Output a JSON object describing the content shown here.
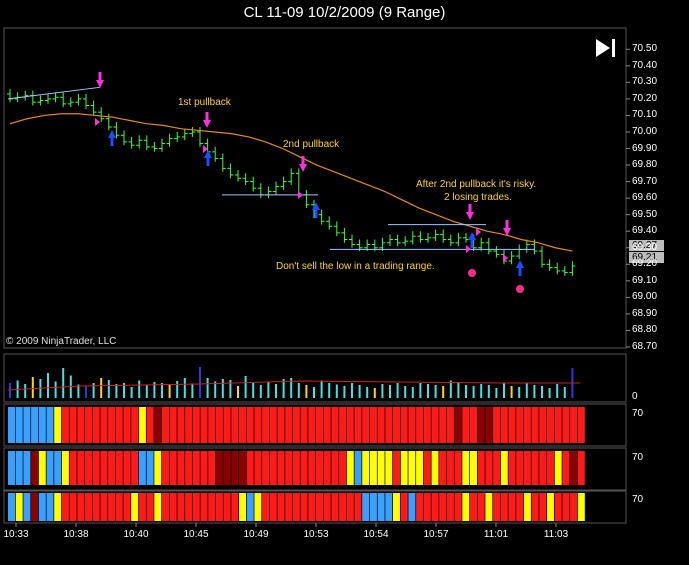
{
  "window_title": "CL 11-09  10/2/2009 (9 Range)",
  "copyright": "© 2009 NinjaTrader, LLC",
  "annotations": {
    "first_pullback": "1st pullback",
    "second_pullback": "2nd pullback",
    "after_second": "After 2nd pullback it's risky.",
    "losing_trades": "2 losing trades.",
    "dont_sell": "Don't sell the low in a trading range."
  },
  "price_badges": {
    "upper": "69.27",
    "lower": "69.21"
  },
  "indicator_labels": {
    "volume": "0",
    "ind1": "70",
    "ind2": "70",
    "ind3": "70"
  },
  "colors": {
    "up_bar": "#3cff3c",
    "down_bar": "#3cff3c",
    "ema": "#e08a20",
    "annotation": "#ffd21f",
    "signal_down": "#ff2ee0",
    "signal_up": "#1e4bff",
    "volume": "#48e0e0"
  },
  "icons": {
    "play": "skip-to-end-icon"
  },
  "chart_data": {
    "type": "ohlc",
    "title": "CL 11-09  10/2/2009 (9 Range)",
    "y_ticks": [
      "70.50",
      "70.40",
      "70.30",
      "70.20",
      "70.10",
      "70.00",
      "69.90",
      "69.80",
      "69.70",
      "69.60",
      "69.50",
      "69.40",
      "69.30",
      "69.20",
      "69.10",
      "69.00",
      "68.90",
      "68.80",
      "68.70"
    ],
    "ylim": [
      68.7,
      70.55
    ],
    "x_labels": [
      "10:33",
      "10:38",
      "10:40",
      "10:45",
      "10:49",
      "10:53",
      "10:54",
      "10:57",
      "11:01",
      "11:03"
    ],
    "closes": [
      70.2,
      70.21,
      70.22,
      70.18,
      70.19,
      70.2,
      70.21,
      70.17,
      70.18,
      70.2,
      70.16,
      70.12,
      70.08,
      70.03,
      69.98,
      69.94,
      69.92,
      69.95,
      69.91,
      69.9,
      69.93,
      69.96,
      69.97,
      69.99,
      70.0,
      69.93,
      69.88,
      69.84,
      69.78,
      69.74,
      69.72,
      69.7,
      69.66,
      69.62,
      69.64,
      69.67,
      69.7,
      69.75,
      69.62,
      69.56,
      69.5,
      69.46,
      69.43,
      69.39,
      69.35,
      69.32,
      69.3,
      69.32,
      69.3,
      69.33,
      69.35,
      69.33,
      69.34,
      69.37,
      69.35,
      69.36,
      69.38,
      69.35,
      69.33,
      69.36,
      69.35,
      69.3,
      69.33,
      69.28,
      69.26,
      69.22,
      69.25,
      69.29,
      69.32,
      69.28,
      69.2,
      69.18,
      69.16,
      69.15,
      69.19
    ],
    "ema": [
      70.05,
      70.08,
      70.1,
      70.11,
      70.11,
      70.1,
      70.09,
      70.07,
      70.05,
      70.04,
      70.02,
      70.01,
      70.0,
      69.99,
      69.97,
      69.94,
      69.9,
      69.85,
      69.8,
      69.76,
      69.72,
      69.68,
      69.64,
      69.59,
      69.54,
      69.5,
      69.46,
      69.43,
      69.4,
      69.38,
      69.35,
      69.33,
      69.3,
      69.28
    ],
    "volume": [
      30,
      35,
      28,
      42,
      38,
      50,
      33,
      60,
      45,
      27,
      25,
      30,
      40,
      36,
      28,
      30,
      22,
      35,
      27,
      32,
      30,
      26,
      34,
      40,
      29,
      62,
      40,
      33,
      38,
      36,
      24,
      44,
      30,
      26,
      33,
      28,
      38,
      40,
      30,
      26,
      22,
      35,
      30,
      27,
      24,
      30,
      26,
      22,
      20,
      28,
      26,
      30,
      24,
      22,
      30,
      28,
      26,
      24,
      35,
      30,
      26,
      24,
      28,
      26,
      20,
      30,
      24,
      22,
      30,
      26,
      24,
      20,
      28,
      22,
      60
    ],
    "indicator_rows": [
      [
        "B",
        "B",
        "B",
        "B",
        "B",
        "B",
        "Y",
        "R",
        "R",
        "R",
        "R",
        "R",
        "R",
        "R",
        "R",
        "R",
        "R",
        "Y",
        "R",
        "D",
        "R",
        "R",
        "R",
        "R",
        "R",
        "R",
        "R",
        "R",
        "R",
        "R",
        "R",
        "R",
        "R",
        "R",
        "R",
        "R",
        "R",
        "R",
        "R",
        "R",
        "R",
        "R",
        "R",
        "R",
        "R",
        "R",
        "R",
        "R",
        "R",
        "R",
        "R",
        "R",
        "R",
        "R",
        "R",
        "R",
        "R",
        "R",
        "D",
        "R",
        "R",
        "D",
        "D",
        "R",
        "R",
        "R",
        "R",
        "R",
        "R",
        "R",
        "R",
        "R",
        "R",
        "R",
        "R"
      ],
      [
        "B",
        "B",
        "B",
        "D",
        "Y",
        "B",
        "B",
        "Y",
        "R",
        "R",
        "R",
        "R",
        "R",
        "R",
        "R",
        "R",
        "R",
        "B",
        "B",
        "Y",
        "R",
        "R",
        "R",
        "R",
        "R",
        "R",
        "R",
        "D",
        "D",
        "D",
        "D",
        "R",
        "R",
        "R",
        "R",
        "R",
        "R",
        "R",
        "R",
        "R",
        "R",
        "R",
        "R",
        "R",
        "Y",
        "B",
        "Y",
        "Y",
        "Y",
        "Y",
        "R",
        "Y",
        "Y",
        "Y",
        "R",
        "Y",
        "R",
        "R",
        "R",
        "Y",
        "Y",
        "R",
        "R",
        "R",
        "Y",
        "R",
        "R",
        "R",
        "R",
        "R",
        "R",
        "Y",
        "R",
        "D",
        "R"
      ],
      [
        "B",
        "Y",
        "B",
        "D",
        "B",
        "B",
        "Y",
        "R",
        "R",
        "R",
        "R",
        "R",
        "R",
        "R",
        "R",
        "R",
        "Y",
        "R",
        "R",
        "Y",
        "R",
        "R",
        "R",
        "R",
        "R",
        "R",
        "R",
        "R",
        "R",
        "R",
        "Y",
        "B",
        "Y",
        "R",
        "R",
        "R",
        "R",
        "R",
        "R",
        "R",
        "R",
        "R",
        "R",
        "R",
        "R",
        "R",
        "B",
        "B",
        "B",
        "B",
        "Y",
        "R",
        "B",
        "R",
        "R",
        "R",
        "R",
        "R",
        "R",
        "Y",
        "R",
        "R",
        "Y",
        "R",
        "R",
        "R",
        "R",
        "Y",
        "R",
        "R",
        "Y",
        "R",
        "R",
        "R",
        "Y"
      ]
    ]
  }
}
